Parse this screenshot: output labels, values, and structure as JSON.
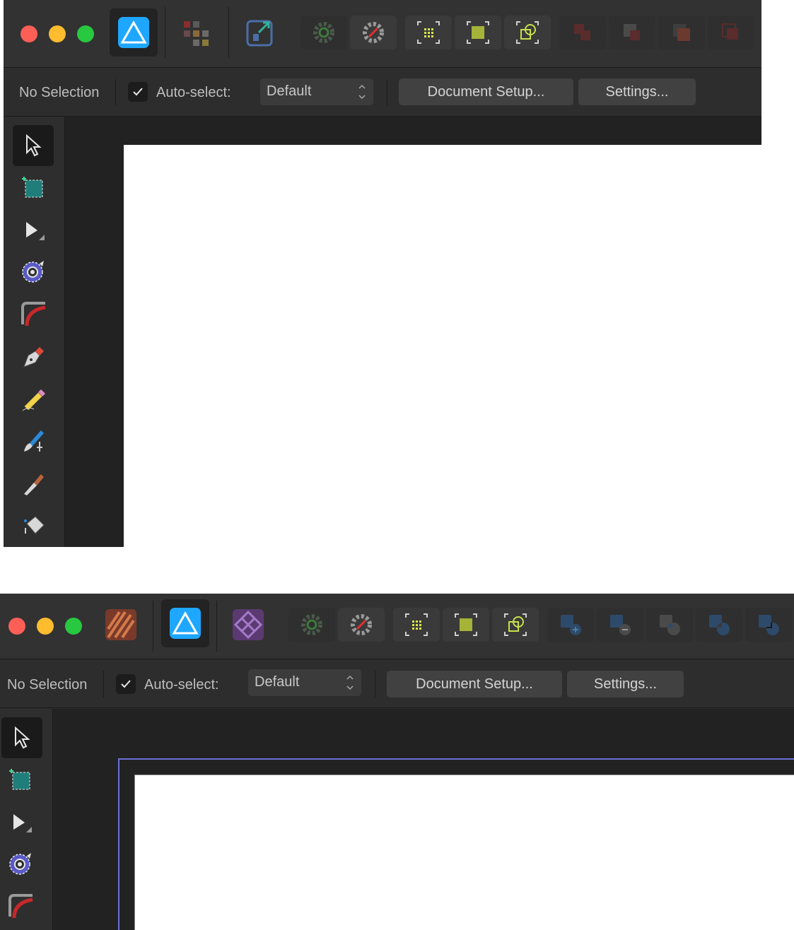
{
  "context_toolbar": {
    "selection_label": "No Selection",
    "autoselect_label": "Auto-select:",
    "autoselect_checked": true,
    "autoselect_mode": "Default",
    "document_setup_label": "Document Setup...",
    "settings_label": "Settings..."
  },
  "screenshots": [
    {
      "persona": "designer",
      "has_photo_persona": false,
      "has_pixel_persona_icon": true,
      "has_export_persona": true
    },
    {
      "persona": "designer",
      "has_publisher_persona": true,
      "has_photo_persona": true
    }
  ],
  "colors": {
    "accent_blue": "#1ea7ff",
    "toolbar_bg": "#323232",
    "canvas": "#ffffff",
    "artboard_outline": "#6b6fd6"
  }
}
